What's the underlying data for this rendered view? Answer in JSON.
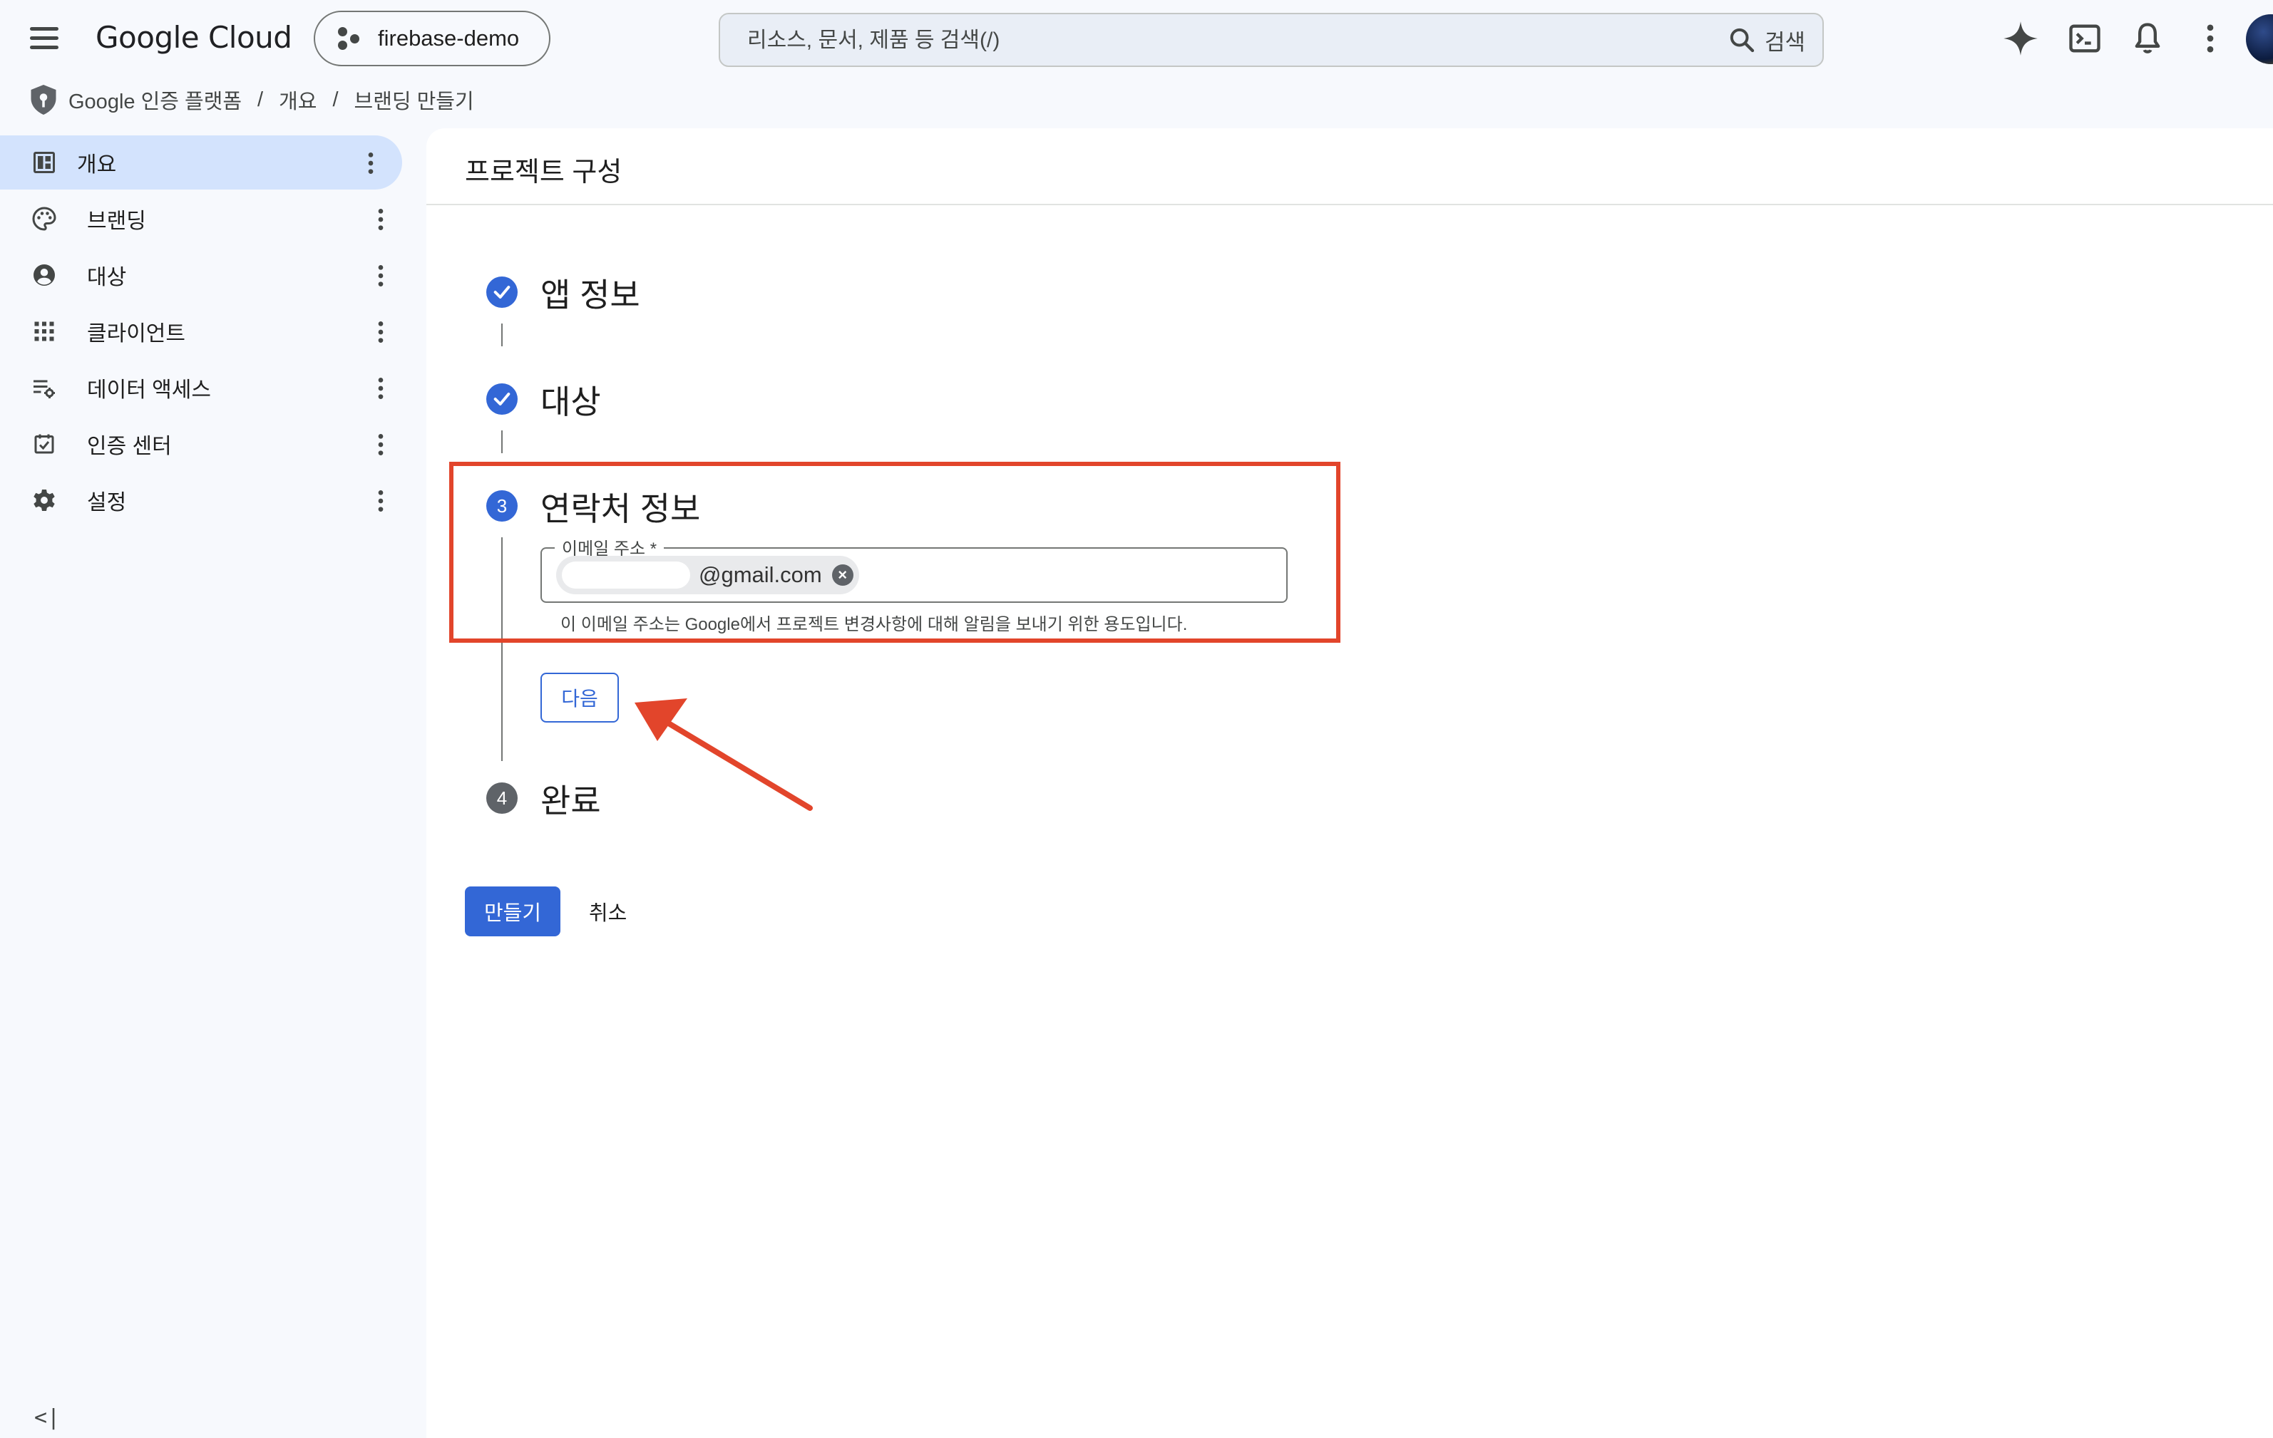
{
  "header": {
    "brand": "Google Cloud",
    "project": "firebase-demo",
    "search_placeholder": "리소스, 문서, 제품 등 검색(/)",
    "search_button": "검색"
  },
  "breadcrumb": {
    "product": "Google 인증 플랫폼",
    "items": [
      "개요",
      "브랜딩 만들기"
    ]
  },
  "sidebar": {
    "items": [
      {
        "label": "개요",
        "icon": "dashboard-icon"
      },
      {
        "label": "브랜딩",
        "icon": "palette-icon"
      },
      {
        "label": "대상",
        "icon": "account-circle-icon"
      },
      {
        "label": "클라이언트",
        "icon": "apps-grid-icon"
      },
      {
        "label": "데이터 액세스",
        "icon": "data-settings-icon"
      },
      {
        "label": "인증 센터",
        "icon": "verified-check-icon"
      },
      {
        "label": "설정",
        "icon": "gear-icon"
      }
    ],
    "collapse_label": "<|"
  },
  "main": {
    "title": "프로젝트 구성",
    "steps": [
      {
        "number": "",
        "label": "앱 정보",
        "status": "done"
      },
      {
        "number": "",
        "label": "대상",
        "status": "done"
      },
      {
        "number": "3",
        "label": "연락처 정보",
        "status": "active"
      },
      {
        "number": "4",
        "label": "완료",
        "status": "pending"
      }
    ],
    "email_field": {
      "label": "이메일 주소 *",
      "chip_value": "@gmail.com",
      "hint": "이 이메일 주소는 Google에서 프로젝트 변경사항에 대해 알림을 보내기 위한 용도입니다."
    },
    "next_button": "다음",
    "create_button": "만들기",
    "cancel_button": "취소"
  },
  "colors": {
    "accent": "#3367d6",
    "nav_active": "#d3e3fd",
    "annotation": "#e2452b"
  }
}
